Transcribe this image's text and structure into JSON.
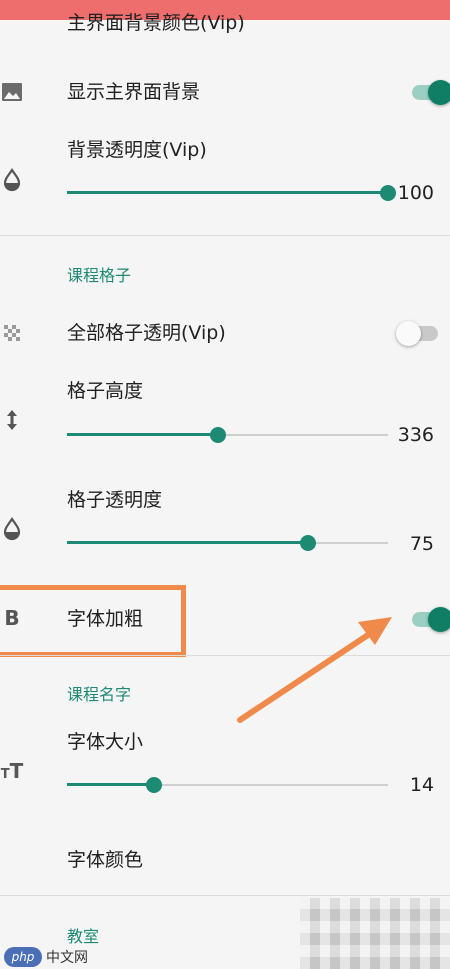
{
  "rows": {
    "bg_color_title": "主界面背景颜色(Vip)",
    "show_bg_title": "显示主界面背景",
    "show_bg_on": true,
    "bg_opacity_title": "背景透明度(Vip)",
    "bg_opacity_value": "100",
    "bg_opacity_level": 100,
    "section_cells": "课程格子",
    "all_cells_transparent_title": "全部格子透明(Vip)",
    "all_cells_transparent_on": false,
    "cell_height_title": "格子高度",
    "cell_height_value": "336",
    "cell_height_level": 47,
    "cell_opacity_title": "格子透明度",
    "cell_opacity_value": "75",
    "cell_opacity_level": 75,
    "bold_title": "字体加粗",
    "bold_on": true,
    "section_course_name": "课程名字",
    "font_size_title": "字体大小",
    "font_size_value": "14",
    "font_size_level": 27,
    "font_color_title": "字体颜色",
    "section_classroom": "教室"
  },
  "icons": {
    "image": "image-icon",
    "drop": "opacity-drop-icon",
    "checker": "transparency-icon",
    "height": "vertical-arrows-icon",
    "bold": "bold-icon",
    "text_size": "text-size-icon"
  },
  "colors": {
    "accent": "#1d8a74",
    "highlight": "#f08a4b",
    "topbar": "#ee6e6e"
  },
  "watermark": {
    "logo": "php",
    "text": "中文网"
  }
}
